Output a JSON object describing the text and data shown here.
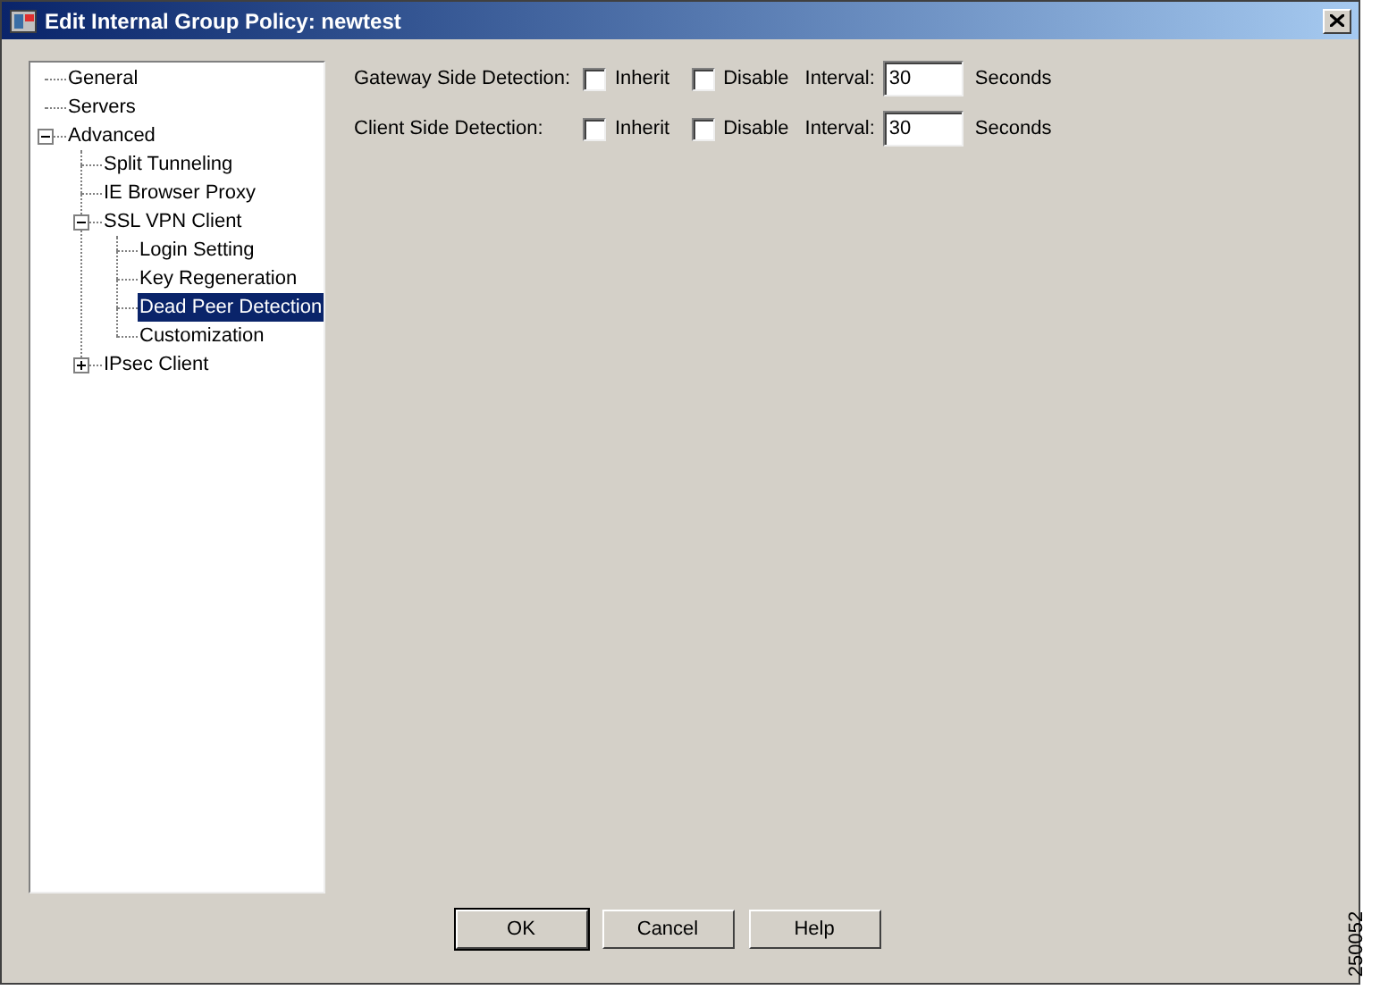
{
  "window": {
    "title": "Edit Internal Group Policy: newtest"
  },
  "tree": [
    {
      "label": "General",
      "selected": false
    },
    {
      "label": "Servers",
      "selected": false
    },
    {
      "label": "Advanced",
      "selected": false,
      "expanded": true,
      "children": [
        {
          "label": "Split Tunneling",
          "selected": false
        },
        {
          "label": "IE Browser Proxy",
          "selected": false
        },
        {
          "label": "SSL VPN Client",
          "selected": false,
          "expanded": true,
          "children": [
            {
              "label": "Login Setting",
              "selected": false
            },
            {
              "label": "Key Regeneration",
              "selected": false
            },
            {
              "label": "Dead Peer Detection",
              "selected": true
            },
            {
              "label": "Customization",
              "selected": false
            }
          ]
        },
        {
          "label": "IPsec Client",
          "selected": false,
          "expanded": false
        }
      ]
    }
  ],
  "rows": [
    {
      "label": "Gateway Side Detection:",
      "inherit": {
        "label": "Inherit",
        "checked": false
      },
      "disable": {
        "label": "Disable",
        "checked": false
      },
      "interval_label": "Interval:",
      "interval": "30",
      "unit": "Seconds"
    },
    {
      "label": "Client Side Detection:",
      "inherit": {
        "label": "Inherit",
        "checked": false
      },
      "disable": {
        "label": "Disable",
        "checked": false
      },
      "interval_label": "Interval:",
      "interval": "30",
      "unit": "Seconds"
    }
  ],
  "buttons": [
    {
      "label": "OK",
      "default": true
    },
    {
      "label": "Cancel",
      "default": false
    },
    {
      "label": "Help",
      "default": false
    }
  ],
  "figure_number": "250052"
}
